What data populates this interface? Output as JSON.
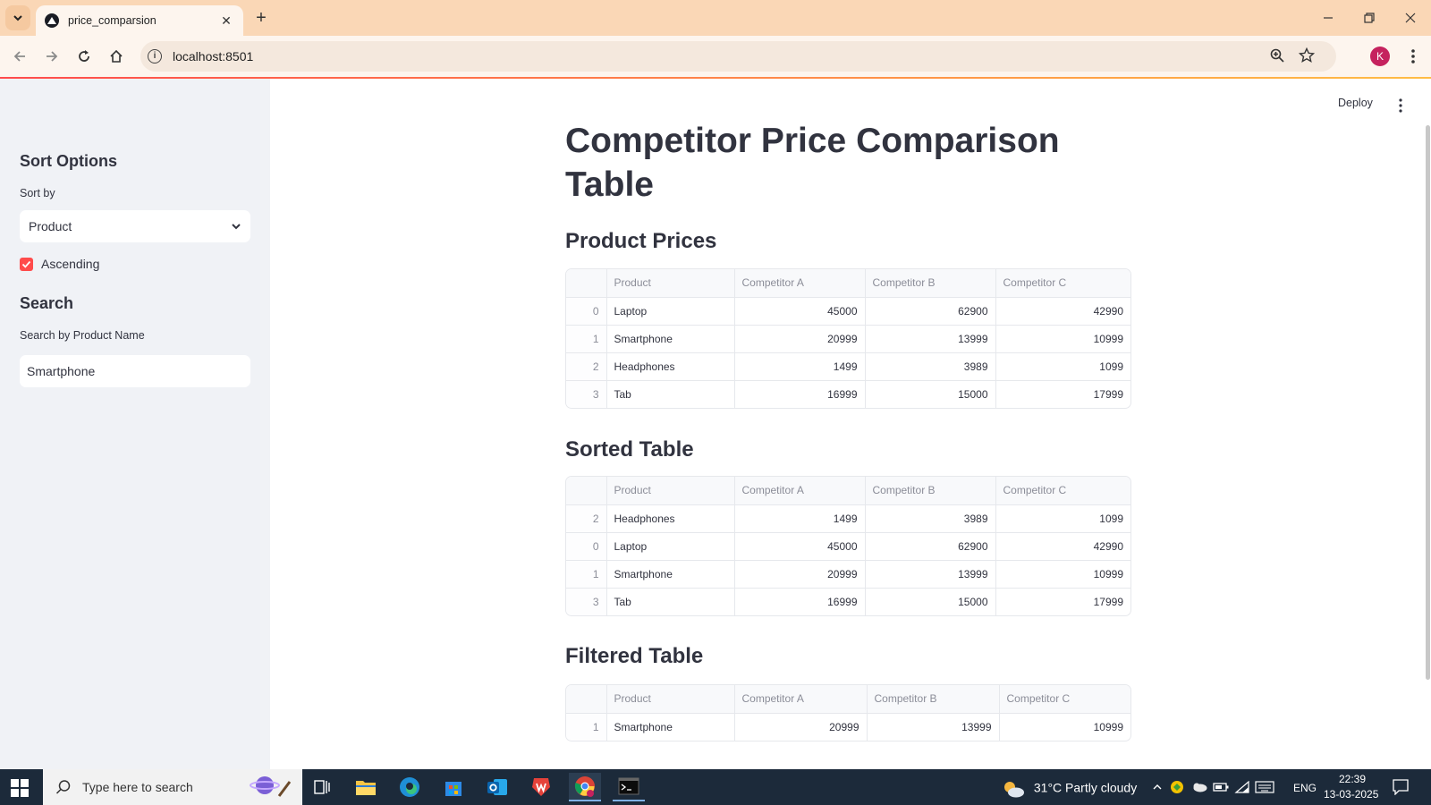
{
  "browser": {
    "tab_title": "price_comparsion",
    "url": "localhost:8501",
    "profile_initial": "K"
  },
  "app": {
    "deploy_label": "Deploy",
    "title": "Competitor Price Comparison Table"
  },
  "sidebar": {
    "sort_heading": "Sort Options",
    "sort_label": "Sort by",
    "sort_value": "Product",
    "ascending_label": "Ascending",
    "ascending_checked": true,
    "search_heading": "Search",
    "search_label": "Search by Product Name",
    "search_value": "Smartphone"
  },
  "columns": [
    "",
    "Product",
    "Competitor A",
    "Competitor B",
    "Competitor C"
  ],
  "tables": {
    "prices": {
      "heading": "Product Prices",
      "rows": [
        [
          "0",
          "Laptop",
          "45000",
          "62900",
          "42990"
        ],
        [
          "1",
          "Smartphone",
          "20999",
          "13999",
          "10999"
        ],
        [
          "2",
          "Headphones",
          "1499",
          "3989",
          "1099"
        ],
        [
          "3",
          "Tab",
          "16999",
          "15000",
          "17999"
        ]
      ]
    },
    "sorted": {
      "heading": "Sorted Table",
      "rows": [
        [
          "2",
          "Headphones",
          "1499",
          "3989",
          "1099"
        ],
        [
          "0",
          "Laptop",
          "45000",
          "62900",
          "42990"
        ],
        [
          "1",
          "Smartphone",
          "20999",
          "13999",
          "10999"
        ],
        [
          "3",
          "Tab",
          "16999",
          "15000",
          "17999"
        ]
      ]
    },
    "filtered": {
      "heading": "Filtered Table",
      "rows": [
        [
          "1",
          "Smartphone",
          "20999",
          "13999",
          "10999"
        ]
      ]
    }
  },
  "taskbar": {
    "search_placeholder": "Type here to search",
    "weather": "31°C  Partly cloudy",
    "language": "ENG",
    "time": "22:39",
    "date": "13-03-2025"
  },
  "colors": {
    "accent": "#ff4b4b",
    "sidebar_bg": "#f0f2f6",
    "tabstrip_bg": "#fad7b6"
  }
}
